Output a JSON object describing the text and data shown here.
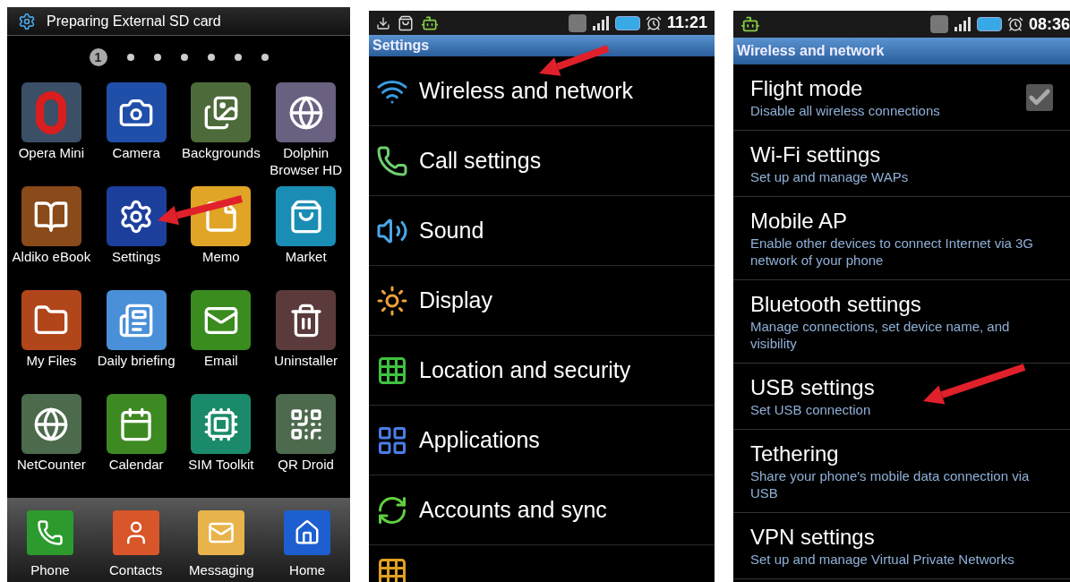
{
  "home_screen": {
    "notification": "Preparing External SD card",
    "pages": [
      {
        "label": "1",
        "selected": true
      },
      {
        "selected": false
      },
      {
        "selected": false
      },
      {
        "selected": false
      },
      {
        "selected": false
      },
      {
        "selected": false
      },
      {
        "selected": false
      }
    ],
    "apps": [
      {
        "label": "Opera Mini"
      },
      {
        "label": "Camera"
      },
      {
        "label": "Backgrounds"
      },
      {
        "label": "Dolphin Browser HD"
      },
      {
        "label": "Aldiko eBook"
      },
      {
        "label": "Settings"
      },
      {
        "label": "Memo"
      },
      {
        "label": "Market"
      },
      {
        "label": "My Files"
      },
      {
        "label": "Daily briefing"
      },
      {
        "label": "Email"
      },
      {
        "label": "Uninstaller"
      },
      {
        "label": "NetCounter"
      },
      {
        "label": "Calendar"
      },
      {
        "label": "SIM Toolkit"
      },
      {
        "label": "QR Droid"
      }
    ],
    "dock": [
      {
        "label": "Phone"
      },
      {
        "label": "Contacts"
      },
      {
        "label": "Messaging"
      },
      {
        "label": "Home"
      }
    ]
  },
  "settings_screen": {
    "status_time": "11:21",
    "title": "Settings",
    "items": [
      {
        "label": "Wireless and network"
      },
      {
        "label": "Call settings"
      },
      {
        "label": "Sound"
      },
      {
        "label": "Display"
      },
      {
        "label": "Location and security"
      },
      {
        "label": "Applications"
      },
      {
        "label": "Accounts and sync"
      }
    ]
  },
  "wireless_screen": {
    "status_time": "08:36",
    "title": "Wireless and network",
    "items": [
      {
        "kind": "checkbox",
        "title": "Flight mode",
        "summary": "Disable all wireless connections",
        "checked": true
      },
      {
        "kind": "link",
        "title": "Wi-Fi settings",
        "summary": "Set up and manage WAPs"
      },
      {
        "kind": "link",
        "title": "Mobile AP",
        "summary": "Enable other devices to connect Internet via 3G network of your phone"
      },
      {
        "kind": "link",
        "title": "Bluetooth settings",
        "summary": "Manage connections, set device name, and visibility"
      },
      {
        "kind": "link",
        "title": "USB settings",
        "summary": "Set USB connection"
      },
      {
        "kind": "link",
        "title": "Tethering",
        "summary": "Share your phone's mobile data connection via USB"
      },
      {
        "kind": "link",
        "title": "VPN settings",
        "summary": "Set up and manage Virtual Private Networks"
      }
    ]
  }
}
